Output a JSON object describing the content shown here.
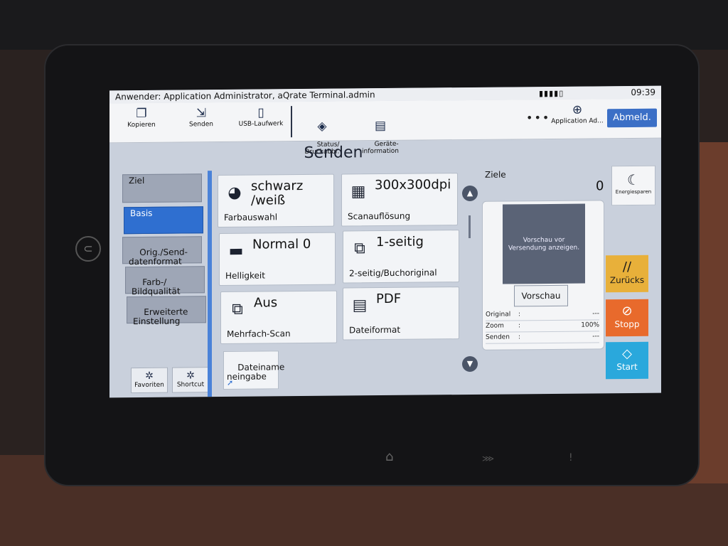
{
  "status": {
    "user": "Anwender: Application Administrator, aQrate Terminal.admin",
    "time": "09:39"
  },
  "toolbar": {
    "items": [
      {
        "label": "Kopieren",
        "icon": "copy-icon"
      },
      {
        "label": "Senden",
        "icon": "send-icon"
      },
      {
        "label": "USB-Laufwerk",
        "icon": "usb-icon"
      },
      {
        "label": "Status/\nDruckabbr.",
        "icon": "status-icon"
      },
      {
        "label": "Geräte-\ninformation",
        "icon": "device-info-icon"
      }
    ],
    "more_label": "•••",
    "app_label": "Application Ad...",
    "logout_label": "Abmeld."
  },
  "title": "Senden",
  "tabs": [
    {
      "label": "Ziel",
      "active": false
    },
    {
      "label": "Basis",
      "active": true
    },
    {
      "label": "Orig./Send-\ndatenformat",
      "active": false
    },
    {
      "label": "Farb-/\nBildqualität",
      "active": false
    },
    {
      "label": "Erweiterte\nEinstellung",
      "active": false
    }
  ],
  "bottom_buttons": {
    "favorites": "Favoriten",
    "shortcut": "Shortcut"
  },
  "tiles": [
    {
      "value": "schwarz\n/weiß",
      "label": "Farbauswahl",
      "icon": "color-mode-icon"
    },
    {
      "value": "300x300dpi",
      "label": "Scanauflösung",
      "icon": "resolution-icon"
    },
    {
      "value": "Normal 0",
      "label": "Helligkeit",
      "icon": "brightness-icon"
    },
    {
      "value": "1-seitig",
      "label": "2-seitig/Buchoriginal",
      "icon": "duplex-icon"
    },
    {
      "value": "Aus",
      "label": "Mehrfach-Scan",
      "icon": "multi-scan-icon"
    },
    {
      "value": "PDF",
      "label": "Dateiformat",
      "icon": "pdf-icon"
    }
  ],
  "filename_tile": "Dateiname\nneingabe",
  "preview": {
    "ziele_label": "Ziele",
    "ziele_count": "0",
    "placeholder": "Vorschau vor\nVersendung anzeigen.",
    "button_label": "Vorschau",
    "info": [
      {
        "key": "Original",
        "colon": ":",
        "value": "---"
      },
      {
        "key": "Zoom",
        "colon": ":",
        "value": "100%"
      },
      {
        "key": "Senden",
        "colon": ":",
        "value": "---"
      }
    ]
  },
  "side_buttons": {
    "energy": "Energiesparen",
    "back": "Zurücks",
    "stop": "Stopp",
    "start": "Start"
  },
  "colors": {
    "accent": "#2f6fd0",
    "back": "#e8b03a",
    "stop": "#e86a2c",
    "start": "#2aa8dc"
  }
}
